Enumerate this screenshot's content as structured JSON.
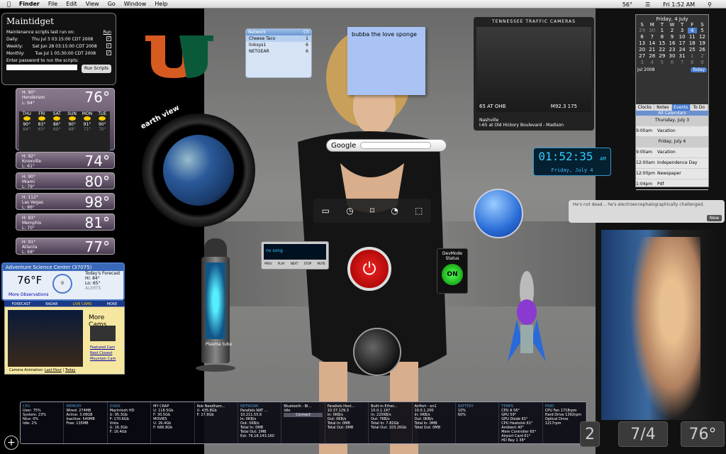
{
  "menubar": {
    "app": "Finder",
    "items": [
      "File",
      "Edit",
      "View",
      "Go",
      "Window",
      "Help"
    ],
    "clock": "Fri 1:52 AM",
    "battery": "56°"
  },
  "maintidget": {
    "title": "Maintidget",
    "subtitle": "Maintenance scripts last run on:",
    "run_label": "Run",
    "rows": [
      {
        "label": "Daily:",
        "value": "Thu Jul 3 03:15:00 CDT 2008"
      },
      {
        "label": "Weekly:",
        "value": "Sat Jun 28 03:15:00 CDT 2008"
      },
      {
        "label": "Monthly:",
        "value": "Tue Jul 1 05:30:00 CDT 2008"
      }
    ],
    "password_prompt": "Enter password to run the scripts:",
    "button": "Run Scripts"
  },
  "weather_main": {
    "city": "Henderson",
    "hi": "H: 90°",
    "lo": "L: 64°",
    "temp": "76°",
    "days": [
      {
        "d": "THU",
        "t": "90°",
        "l": "64°"
      },
      {
        "d": "FRI",
        "t": "83°",
        "l": "65°"
      },
      {
        "d": "SAT",
        "t": "86°",
        "l": "69°"
      },
      {
        "d": "SUN",
        "t": "90°",
        "l": "68°"
      },
      {
        "d": "MON",
        "t": "91°",
        "l": "71°"
      },
      {
        "d": "TUE",
        "t": "90°",
        "l": "70°"
      }
    ]
  },
  "weather_small": [
    {
      "city": "Knoxville",
      "hi": "H: 92°",
      "lo": "L: 61°",
      "temp": "74°"
    },
    {
      "city": "Miami",
      "hi": "H: 90°",
      "lo": "L: 79°",
      "temp": "80°"
    },
    {
      "city": "Las Vegas",
      "hi": "H: 112°",
      "lo": "L: 86°",
      "temp": "98°"
    },
    {
      "city": "Memphis",
      "hi": "H: 93°",
      "lo": "L: 70°",
      "temp": "81°"
    },
    {
      "city": "Atlanta",
      "hi": "H: 91°",
      "lo": "L: 68°",
      "temp": "77°"
    }
  ],
  "earth": {
    "label": "earth view"
  },
  "network": {
    "header": "Network",
    "col": "Ch",
    "rows": [
      {
        "name": "Cheese Taco",
        "ch": "1"
      },
      {
        "name": "linksys1",
        "ch": "6"
      },
      {
        "name": "NETGEAR",
        "ch": "6"
      }
    ]
  },
  "sticky": {
    "text": "bubba the love sponge"
  },
  "cams": {
    "title": "TENNESSEE TRAFFIC CAMERAS",
    "overlay_left": "65 AT OHB",
    "overlay_right": "M92.3 175",
    "city": "Nashville",
    "caption": "I-65 at Old Hickory Boulevard - Madison"
  },
  "calendar": {
    "header": "Friday, 4 July",
    "dow": [
      "S",
      "M",
      "T",
      "W",
      "T",
      "F",
      "S"
    ],
    "days": [
      "29",
      "30",
      "1",
      "2",
      "3",
      "4",
      "5",
      "6",
      "7",
      "8",
      "9",
      "10",
      "11",
      "12",
      "13",
      "14",
      "15",
      "16",
      "17",
      "18",
      "19",
      "20",
      "21",
      "22",
      "23",
      "24",
      "25",
      "26",
      "27",
      "28",
      "29",
      "30",
      "31",
      "1",
      "2",
      "3",
      "4",
      "5",
      "6",
      "7",
      "8",
      "9"
    ],
    "month": "Jul 2008",
    "today": "Today",
    "tabs": [
      "Clocks",
      "Notes",
      "Events",
      "To Do"
    ],
    "list": "All Calendars",
    "events": [
      {
        "sec": "Thursday, July 3"
      },
      {
        "time": "9:00am",
        "title": "Vacation"
      },
      {
        "sec": "Friday, July 4"
      },
      {
        "time": "9:00am",
        "title": "Vacation"
      },
      {
        "time": "12:00am",
        "title": "Independence Day"
      },
      {
        "time": "12:00pm",
        "title": "Newspaper"
      },
      {
        "time": "1:04pm",
        "title": "Pdf"
      }
    ]
  },
  "google": {
    "label": "Google"
  },
  "clock": {
    "time": "01:52:35",
    "ampm": "AM",
    "date": "Friday, July 4"
  },
  "message": {
    "text": "He's not dead... he's electroencephalographically challenged.",
    "button": "New"
  },
  "itunes": {
    "track": "no song",
    "controls": [
      "PREV",
      "PLAY",
      "NEXT",
      "STOP",
      "MUTE"
    ]
  },
  "devmode": {
    "title": "DevMode Status",
    "state": "ON"
  },
  "lava": {
    "label": "Plasma tube"
  },
  "asc": {
    "title": "Adventure Science Center (37075)",
    "temp": "76°F",
    "wind": "0",
    "more": "More Observations",
    "fc_title": "Today's Forecast",
    "hi": "Hi: 84°",
    "lo": "Lo: 65°",
    "alerts": "ALERTS",
    "tabs": [
      "FORECAST",
      "RADAR",
      "LIVE CAMS",
      "MORE"
    ]
  },
  "morecams": {
    "title": "More Cams",
    "links": [
      "Featured Cam",
      "Next Closest",
      "Mountain Cam"
    ],
    "anim_label": "Camera Animation:",
    "last_hour": "Last Hour",
    "today": "Today"
  },
  "status": [
    {
      "h": "CPU",
      "lines": [
        "User: 75%",
        "System: 23%",
        "Nice: 0%",
        "Idle: 2%"
      ]
    },
    {
      "h": "MEMORY",
      "lines": [
        "Wired: 274MB",
        "Active: 3.08GB",
        "Inactive: 540MB",
        "Free: 135MB"
      ]
    },
    {
      "h": "DISKS",
      "lines": [
        "Macintosh HD",
        "U: 95.3Gb",
        "F: 170.6Gb",
        "Vista",
        "U: 16.3Gb",
        "F: 16.4Gb"
      ]
    },
    {
      "h": "",
      "lines": [
        "MY CRAP",
        "U: 118.5Gb",
        "F: 30.5Gb",
        "MOVIES",
        "U: 26.4Gb",
        "F: 666.8Gb"
      ]
    },
    {
      "h": "",
      "lines": [
        "Rob Needham...",
        "U: 435.8Gb",
        "F: 27.9Gb"
      ]
    },
    {
      "h": "NETWORK",
      "lines": [
        "Parallels NAT ...",
        "10.211.55.6",
        "In: 0KB/s",
        "Out: 0KB/s",
        "Total In: 0MB",
        "Total Out: 2MB",
        "Ext: 76.18.143.160"
      ]
    },
    {
      "h": "",
      "lines": [
        "Bluetooth - Bl...",
        "Idle",
        "Connect"
      ]
    },
    {
      "h": "",
      "lines": [
        "Parallels Host...",
        "10.37.129.3",
        "In: 0KB/s",
        "Out: 0KB/s",
        "Total In: 0MB",
        "Total Out: 0MB"
      ]
    },
    {
      "h": "",
      "lines": [
        "Built-in Ether...",
        "10.0.1.197",
        "In: 225KB/s",
        "Out: 7KB/s",
        "Total In: 7.82Gb",
        "Total Out: 103.20Gb"
      ]
    },
    {
      "h": "",
      "lines": [
        "AirPort - en1",
        "10.0.1.200",
        "In: 0KB/s",
        "Out: 0KB/s",
        "Total In: 0MB",
        "Total Out: 0MB"
      ]
    },
    {
      "h": "BATTERY",
      "lines": [
        "10%",
        "60%"
      ]
    },
    {
      "h": "TEMPS",
      "lines": [
        "CPU A 56°",
        "GPU 59°",
        "GPU Diode 61°",
        "CPU Heatsink 61°",
        "Ambient 40°",
        "Mem Controller 65°",
        "Airport Card 61°",
        "HD Bay 1 38°"
      ]
    },
    {
      "h": "FANS",
      "lines": [
        "CPU Fan 1718rpm",
        "Hard Drive 1392rpm",
        "Optical Drive 1217rpm"
      ]
    }
  ],
  "tiles": [
    "2",
    "7/4",
    "76°"
  ]
}
